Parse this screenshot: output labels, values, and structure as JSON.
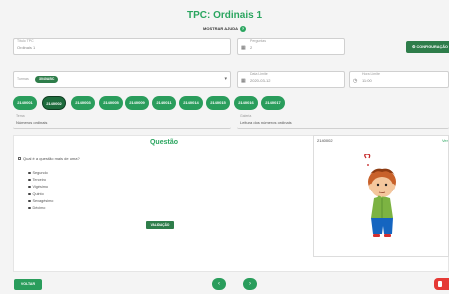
{
  "app": {
    "title": "TPC: Ordinais 1",
    "help_label": "MOSTRAR AJUDA",
    "help_icon": "question-icon"
  },
  "fields": {
    "title": {
      "label": "Título TPC",
      "value": "Ordinais 1"
    },
    "questions": {
      "label": "Perguntas",
      "value": "2"
    },
    "classes": {
      "label": "Turmas",
      "chip": "3040ABC"
    },
    "date": {
      "label": "Data Limite",
      "value": "2020-03-12"
    },
    "time": {
      "label": "Hora Limite",
      "value": "11:00"
    },
    "theme": {
      "label": "Tema",
      "value": "Números ordinais"
    },
    "category": {
      "label": "Galeria",
      "value": "Leitura dos números ordinais"
    }
  },
  "config_button": "CONFIGURAÇÃO",
  "question_tabs": [
    "2140001",
    "2140002",
    "2140003",
    "2140005",
    "2140009",
    "2140011",
    "2140014",
    "2140015",
    "2140016",
    "2140017"
  ],
  "active_tab_index": 1,
  "question": {
    "heading": "Questão",
    "text": "Qual é a questão mais de uma?",
    "options": [
      "Segundo",
      "Terceiro",
      "Vigésimo",
      "Quinto",
      "Sexagésimo",
      "Décimo"
    ],
    "validate_label": "VALIDAÇÃO"
  },
  "image_card": {
    "code": "2140002",
    "link": "Ver"
  },
  "footer": {
    "back_label": "VOLTAR",
    "prev_icon": "chevron-left-icon",
    "next_icon": "chevron-right-icon"
  }
}
